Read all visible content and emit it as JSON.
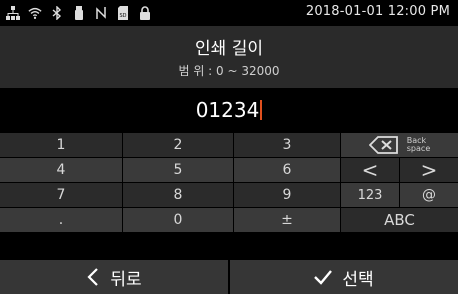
{
  "status": {
    "icons": [
      "network-icon",
      "wifi-icon",
      "bluetooth-icon",
      "usb-icon",
      "nfc-icon",
      "sd-card-icon",
      "lock-icon"
    ],
    "datetime": "2018-01-01 12:00 PM"
  },
  "header": {
    "title": "인쇄 길이",
    "range": "범 위 : 0 ~ 32000"
  },
  "input": {
    "value": "01234"
  },
  "keypad": {
    "k1": "1",
    "k2": "2",
    "k3": "3",
    "k4": "4",
    "k5": "5",
    "k6": "6",
    "k7": "7",
    "k8": "8",
    "k9": "9",
    "kdot": ".",
    "k0": "0",
    "kpm": "±",
    "backspace_label_1": "Back",
    "backspace_label_2": "space",
    "left": "<",
    "right": ">",
    "num": "123",
    "at": "@",
    "abc": "ABC"
  },
  "bottom": {
    "back_label": "뒤로",
    "select_label": "선택"
  },
  "colors": {
    "caret": "#e0501e",
    "key_dark": "#2b2b2b",
    "key_mid": "#3a3a3a"
  }
}
